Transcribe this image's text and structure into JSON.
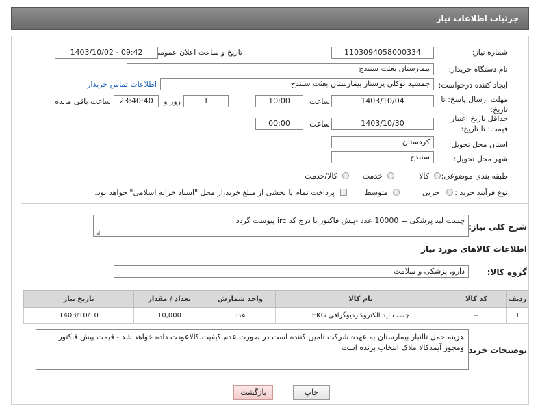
{
  "header": {
    "title": "جزئیات اطلاعات نیاز"
  },
  "form": {
    "need_number_label": "شماره نیاز:",
    "need_number": "1103094058000334",
    "announce_label": "تاریخ و ساعت اعلان عمومی:",
    "announce_value": "1403/10/02 - 09:42",
    "buyer_org_label": "نام دستگاه خریدار:",
    "buyer_org": "بیمارستان بعثت سنندج",
    "creator_label": "ایجاد کننده درخواست:",
    "creator": "جمشید  توکلی پرستار بیمارستان بعثت سنندج",
    "contact_link": "اطلاعات تماس خریدار",
    "deadline_label": "مهلت ارسال پاسخ: تا تاریخ:",
    "deadline_date": "1403/10/04",
    "time_label": "ساعت",
    "deadline_time": "10:00",
    "days_value": "1",
    "days_label": "روز و",
    "remaining_time": "23:40:40",
    "remaining_label": "ساعت باقی مانده",
    "price_validity_label": "حداقل تاریخ اعتبار قیمت: تا تاریخ:",
    "price_validity_date": "1403/10/30",
    "price_validity_time": "00:00",
    "province_label": "استان محل تحویل:",
    "province": "کردستان",
    "city_label": "شهر محل تحویل:",
    "city": "سنندج",
    "category_label": "طبقه بندی موضوعی:",
    "category_options": [
      "کالا",
      "خدمت",
      "کالا/خدمت"
    ],
    "process_label": "نوع فرآیند خرید :",
    "process_options": [
      "جزیی",
      "متوسط"
    ],
    "payment_note": "پرداخت تمام یا بخشی از مبلغ خرید،از محل \"اسناد خزانه اسلامی\" خواهد بود."
  },
  "description": {
    "label": "شرح کلی نیاز:",
    "text": "چست لید پزشکی = 10000 عدد -پیش فاکتور با درج کد irc پیوست گردد"
  },
  "goods_section": {
    "title": "اطلاعات کالاهای مورد نیاز"
  },
  "goods_group": {
    "label": "گروه کالا:",
    "value": "دارو، پزشکی و سلامت"
  },
  "table": {
    "headers": [
      "ردیف",
      "کد کالا",
      "نام کالا",
      "واحد شمارش",
      "تعداد / مقدار",
      "تاریخ نیاز"
    ],
    "rows": [
      [
        "1",
        "--",
        "چست لید الکتروکاردیوگرافی EKG",
        "عدد",
        "10,000",
        "1403/10/10"
      ]
    ]
  },
  "buyer_notes": {
    "label": "توضیحات خریدار:",
    "text": "هزینه حمل تاانبار بیمارستان به عهده شرکت تامین کننده است در صورت عدم کیفیت،کالاعودت داده خواهد شد - قیمت پیش فاکتور ومجوز آیمدکالا ملاک انتخاب برنده است"
  },
  "buttons": {
    "print": "چاپ",
    "back": "بازگشت"
  },
  "colors": {
    "header": "#7a7a7a",
    "link": "#1a5fb4",
    "back_button": "#f7d6d6"
  }
}
